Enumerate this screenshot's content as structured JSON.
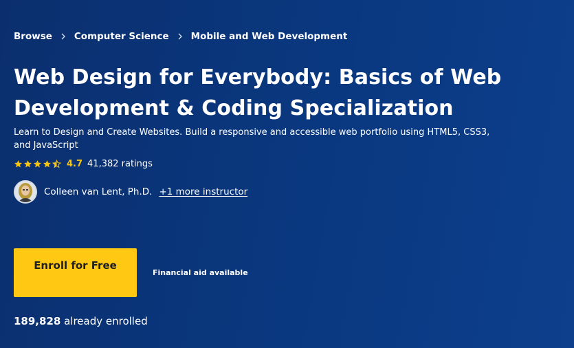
{
  "breadcrumb": {
    "items": [
      "Browse",
      "Computer Science",
      "Mobile and Web Development"
    ]
  },
  "course": {
    "title": "Web Design for Everybody: Basics of Web Development & Coding Specialization",
    "subtitle": "Learn to Design and Create Websites. Build a responsive and accessible web portfolio using HTML5, CSS3, and JavaScript"
  },
  "rating": {
    "value": "4.7",
    "stars": 4.7,
    "count": "41,382 ratings"
  },
  "instructor": {
    "name": "Colleen van Lent, Ph.D.",
    "more_link": "+1 more instructor"
  },
  "enroll": {
    "button_label": "Enroll for Free",
    "financial_aid": "Financial aid available",
    "enrolled_count": "189,828",
    "enrolled_suffix": " already enrolled"
  },
  "colors": {
    "background": "#0a3880",
    "button": "#ffc813",
    "star": "#f5c518"
  }
}
